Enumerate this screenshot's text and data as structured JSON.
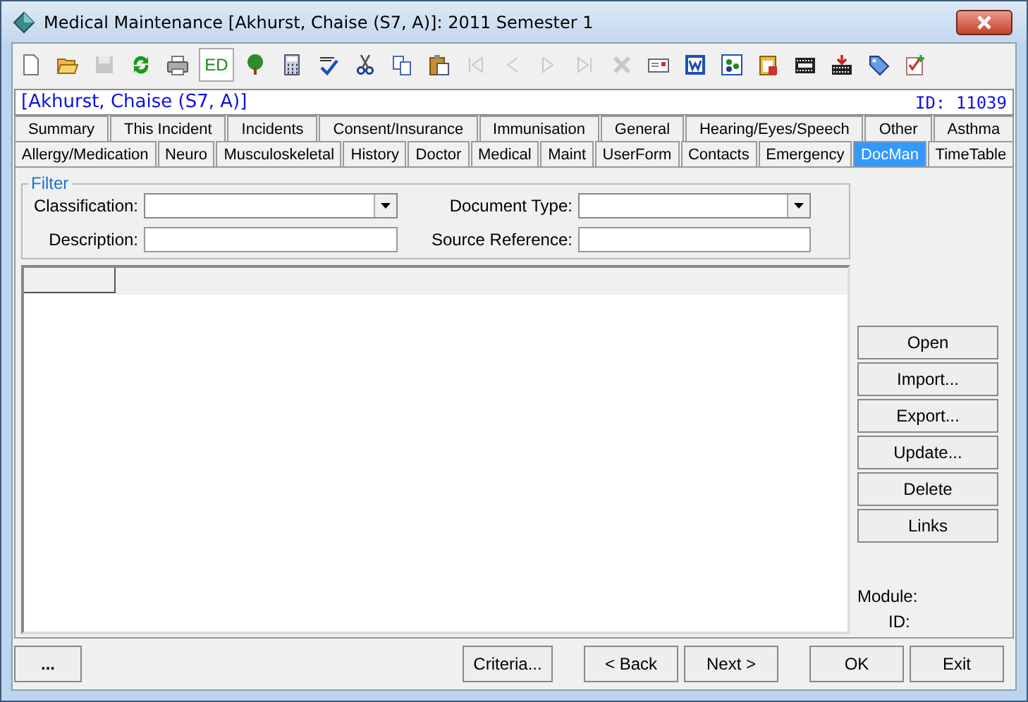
{
  "window": {
    "title": "Medical Maintenance   [Akhurst, Chaise (S7, A)]: 2011 Semester 1"
  },
  "toolbar": [
    {
      "kind": "new",
      "disabled": false
    },
    {
      "kind": "open",
      "disabled": false
    },
    {
      "kind": "save",
      "disabled": true
    },
    {
      "kind": "refresh",
      "disabled": false
    },
    {
      "kind": "print",
      "disabled": false
    },
    {
      "kind": "edit",
      "disabled": false,
      "label": "ED"
    },
    {
      "kind": "tree",
      "disabled": false
    },
    {
      "kind": "calculator",
      "disabled": false
    },
    {
      "kind": "spellcheck",
      "disabled": false
    },
    {
      "kind": "cut",
      "disabled": false
    },
    {
      "kind": "copy",
      "disabled": false
    },
    {
      "kind": "paste",
      "disabled": false
    },
    {
      "kind": "first",
      "disabled": true
    },
    {
      "kind": "prev",
      "disabled": true
    },
    {
      "kind": "next",
      "disabled": true
    },
    {
      "kind": "last",
      "disabled": true
    },
    {
      "kind": "delete",
      "disabled": true
    },
    {
      "kind": "mail",
      "disabled": false
    },
    {
      "kind": "word",
      "disabled": false
    },
    {
      "kind": "dots",
      "disabled": false
    },
    {
      "kind": "clipboard",
      "disabled": false
    },
    {
      "kind": "film",
      "disabled": false
    },
    {
      "kind": "import",
      "disabled": false
    },
    {
      "kind": "tag",
      "disabled": false
    },
    {
      "kind": "checklist",
      "disabled": false
    }
  ],
  "student": {
    "name": "[Akhurst, Chaise (S7, A)]",
    "id": "ID: 11039"
  },
  "tab_rows": [
    [
      {
        "label": "Summary",
        "selected": false
      },
      {
        "label": "This Incident",
        "selected": false
      },
      {
        "label": "Incidents",
        "selected": false
      },
      {
        "label": "Consent/Insurance",
        "selected": false
      },
      {
        "label": "Immunisation",
        "selected": false
      },
      {
        "label": "General",
        "selected": false
      },
      {
        "label": "Hearing/Eyes/Speech",
        "selected": false
      },
      {
        "label": "Other",
        "selected": false
      },
      {
        "label": "Asthma",
        "selected": false
      }
    ],
    [
      {
        "label": "Allergy/Medication",
        "selected": false
      },
      {
        "label": "Neuro",
        "selected": false
      },
      {
        "label": "Musculoskeletal",
        "selected": false
      },
      {
        "label": "History",
        "selected": false
      },
      {
        "label": "Doctor",
        "selected": false
      },
      {
        "label": "Medical",
        "selected": false
      },
      {
        "label": "Maint",
        "selected": false
      },
      {
        "label": "UserForm",
        "selected": false
      },
      {
        "label": "Contacts",
        "selected": false
      },
      {
        "label": "Emergency",
        "selected": false
      },
      {
        "label": "DocMan",
        "selected": true
      },
      {
        "label": "TimeTable",
        "selected": false
      }
    ]
  ],
  "filter": {
    "title": "Filter",
    "fields": [
      {
        "label": "Classification:",
        "kind": "dropdown"
      },
      {
        "label": "Document Type:",
        "kind": "dropdown"
      },
      {
        "label": "Description:",
        "kind": "text"
      },
      {
        "label": "Source Reference:",
        "kind": "text"
      }
    ]
  },
  "side_buttons": [
    "Open",
    "Import...",
    "Export...",
    "Update...",
    "Delete",
    "Links"
  ],
  "info": [
    "Module:",
    "ID:"
  ],
  "footer": {
    "more": "...",
    "buttons": [
      "Criteria...",
      "< Back",
      "Next >",
      "OK",
      "Exit"
    ]
  }
}
